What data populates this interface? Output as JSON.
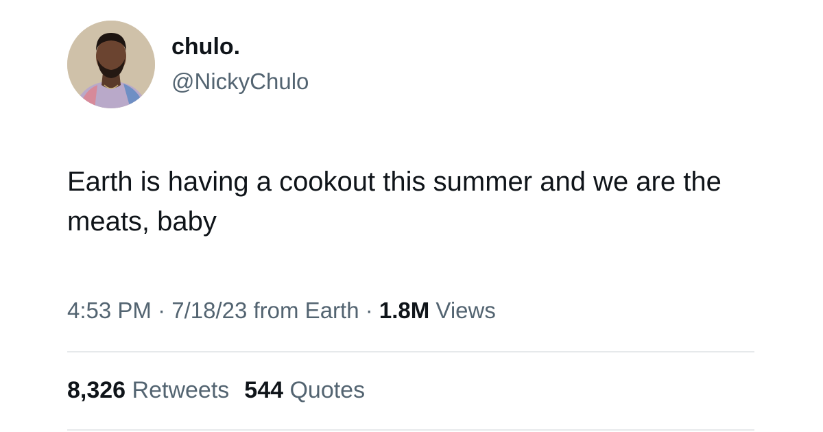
{
  "author": {
    "display_name": "chulo.",
    "handle": "@NickyChulo",
    "avatar_icon": "profile-photo"
  },
  "tweet": {
    "text": "Earth is having a cookout this summer and we are the meats, baby"
  },
  "meta": {
    "time": "4:53 PM",
    "sep1": " · ",
    "date": "7/18/23",
    "source": " from Earth",
    "sep2": " · ",
    "views_count": "1.8M",
    "views_label": " Views"
  },
  "stats": {
    "retweets_count": "8,326",
    "retweets_label": " Retweets",
    "quotes_count": "544",
    "quotes_label": " Quotes"
  },
  "colors": {
    "text_primary": "#0f1419",
    "text_secondary": "#536471",
    "divider": "#e6e9eb"
  }
}
